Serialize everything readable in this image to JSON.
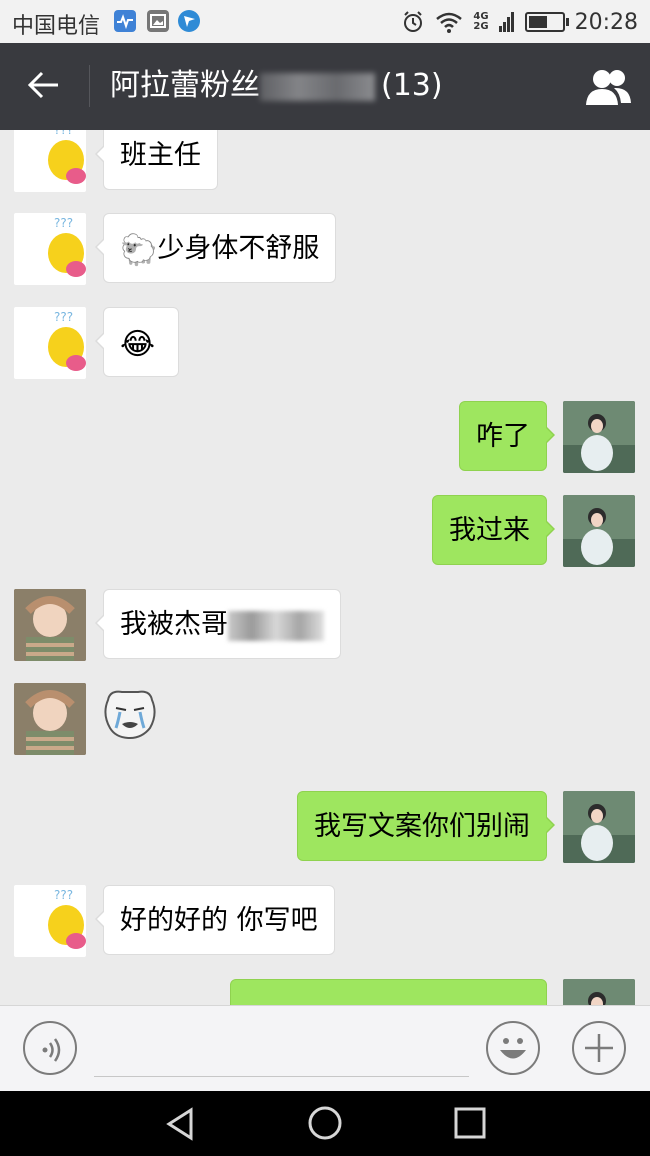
{
  "status_bar": {
    "carrier": "中国电信",
    "network_top": "4G",
    "network_bottom": "2G",
    "time": "20:28",
    "battery_level": 0.55
  },
  "header": {
    "back_icon": "back-arrow-icon",
    "title": "阿拉蕾粉丝",
    "member_count": "(13)",
    "group_icon": "group-members-icon"
  },
  "messages": [
    {
      "side": "left",
      "avatar": "duck-avatar",
      "text": "班主任"
    },
    {
      "side": "left",
      "avatar": "duck-avatar",
      "emoji": "🐑",
      "text": "少身体不舒服"
    },
    {
      "side": "left",
      "avatar": "duck-avatar",
      "emoji": "😂",
      "text": ""
    },
    {
      "side": "right",
      "avatar": "girl-avatar",
      "text": "咋了"
    },
    {
      "side": "right",
      "avatar": "girl-avatar",
      "text": "我过来"
    },
    {
      "side": "left",
      "avatar": "kid-avatar",
      "text": "我被杰哥"
    },
    {
      "side": "left",
      "avatar": "kid-avatar",
      "sticker": "crying-meme-face-sticker",
      "text": ""
    },
    {
      "side": "right",
      "avatar": "girl-avatar",
      "text": "我写文案你们别闹"
    },
    {
      "side": "left",
      "avatar": "duck-avatar",
      "text": "好的好的 你写吧"
    },
    {
      "side": "right",
      "avatar": "girl-avatar",
      "text": ""
    }
  ],
  "input_bar": {
    "voice_icon": "voice-icon",
    "emoji_icon": "emoji-icon",
    "add_icon": "plus-icon",
    "text_value": ""
  },
  "nav_bar": {
    "back": "triangle-back-icon",
    "home": "circle-home-icon",
    "recent": "square-recent-icon"
  },
  "colors": {
    "header_bg": "#393a3f",
    "bubble_sent": "#9ee65f",
    "bubble_received": "#ffffff",
    "chat_bg": "#ebebeb"
  }
}
